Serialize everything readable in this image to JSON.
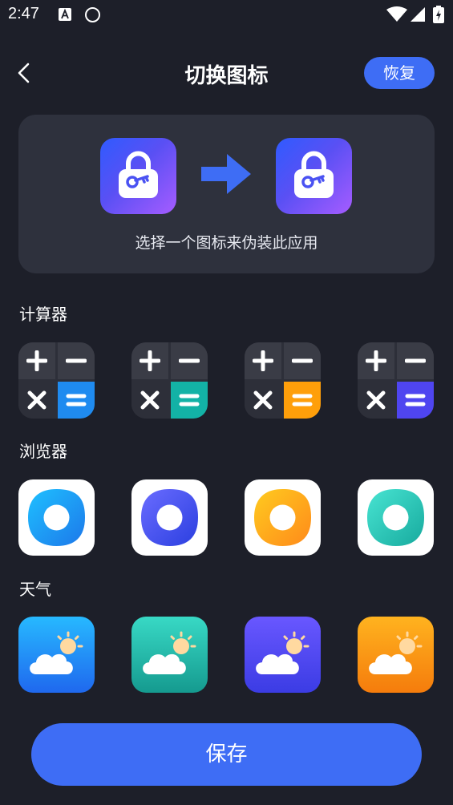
{
  "status_bar": {
    "time": "2:47"
  },
  "header": {
    "title": "切换图标",
    "restore_label": "恢复"
  },
  "preview": {
    "caption": "选择一个图标来伪装此应用"
  },
  "sections": {
    "calculator": {
      "title": "计算器",
      "accent_colors": [
        "#1f8bf0",
        "#13b2a6",
        "#ff9f0a",
        "#4f45f0"
      ]
    },
    "browser": {
      "title": "浏览器",
      "ring_colors": [
        [
          "#1ec0ff",
          "#1d78ea"
        ],
        [
          "#6a6cff",
          "#2b3fe0"
        ],
        [
          "#ffcb1f",
          "#ff8a1a"
        ],
        [
          "#48e4d2",
          "#17aa9e"
        ]
      ]
    },
    "weather": {
      "title": "天气",
      "bg_colors": [
        [
          "#27b9ff",
          "#1f68ee"
        ],
        [
          "#38d9c5",
          "#159a8f"
        ],
        [
          "#6957ff",
          "#3b3ce4"
        ],
        [
          "#ffb31f",
          "#f57c0c"
        ]
      ]
    }
  },
  "footer": {
    "save_label": "保存"
  },
  "colors": {
    "accent": "#3e6df5",
    "background": "#1d1f29",
    "card": "#2e313d"
  }
}
